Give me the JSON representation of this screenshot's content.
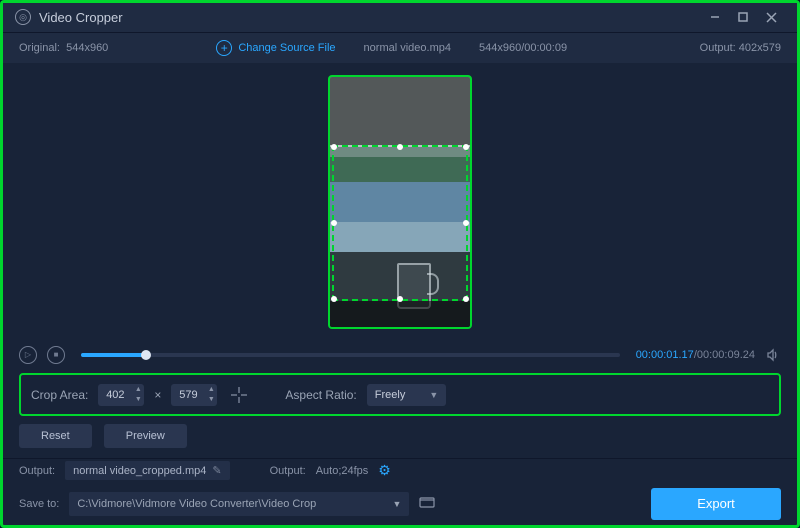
{
  "titlebar": {
    "title": "Video Cropper"
  },
  "infobar": {
    "original_label": "Original:",
    "original_dims": "544x960",
    "change_label": "Change Source File",
    "filename": "normal video.mp4",
    "src_meta": "544x960/00:00:09",
    "output_label": "Output:",
    "output_dims": "402x579"
  },
  "playbar": {
    "current": "00:00:01.17",
    "total": "00:00:09.24"
  },
  "crop": {
    "area_label": "Crop Area:",
    "width": "402",
    "height": "579",
    "times": "×",
    "ratio_label": "Aspect Ratio:",
    "ratio_value": "Freely"
  },
  "buttons": {
    "reset": "Reset",
    "preview": "Preview",
    "export": "Export"
  },
  "output": {
    "label": "Output:",
    "filename": "normal video_cropped.mp4",
    "fmt_label": "Output:",
    "fmt_value": "Auto;24fps"
  },
  "save": {
    "label": "Save to:",
    "path": "C:\\Vidmore\\Vidmore Video Converter\\Video Crop"
  }
}
